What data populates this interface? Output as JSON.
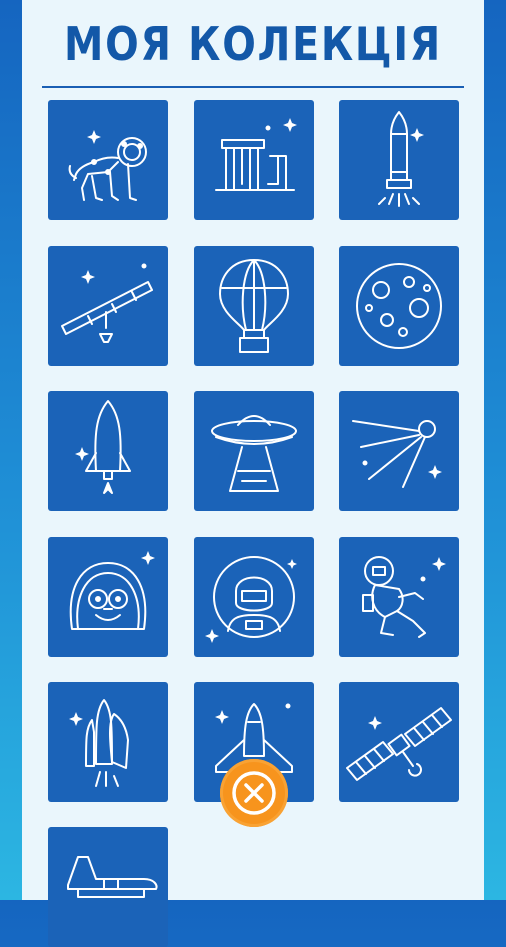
{
  "header": {
    "title": "МОЯ КОЛЕКЦІЯ"
  },
  "collection": {
    "items": [
      {
        "icon": "lion-constellation-icon"
      },
      {
        "icon": "observatory-building-icon"
      },
      {
        "icon": "rocket-launch-icon"
      },
      {
        "icon": "telescope-icon"
      },
      {
        "icon": "hot-air-balloon-icon"
      },
      {
        "icon": "moon-craters-icon"
      },
      {
        "icon": "space-rocket-icon"
      },
      {
        "icon": "ufo-icon"
      },
      {
        "icon": "sputnik-satellite-icon"
      },
      {
        "icon": "monkey-astronaut-icon"
      },
      {
        "icon": "astronaut-helmet-icon"
      },
      {
        "icon": "floating-astronaut-icon"
      },
      {
        "icon": "space-shuttle-launch-icon"
      },
      {
        "icon": "space-shuttle-icon"
      },
      {
        "icon": "solar-panel-satellite-icon"
      },
      {
        "icon": "shuttle-side-icon"
      }
    ]
  },
  "close_button": {
    "icon": "close-x-icon",
    "color": "#f7941d"
  },
  "colors": {
    "tile": "#1b63b8",
    "panel": "#eaf6fc",
    "title": "#1358a8"
  }
}
